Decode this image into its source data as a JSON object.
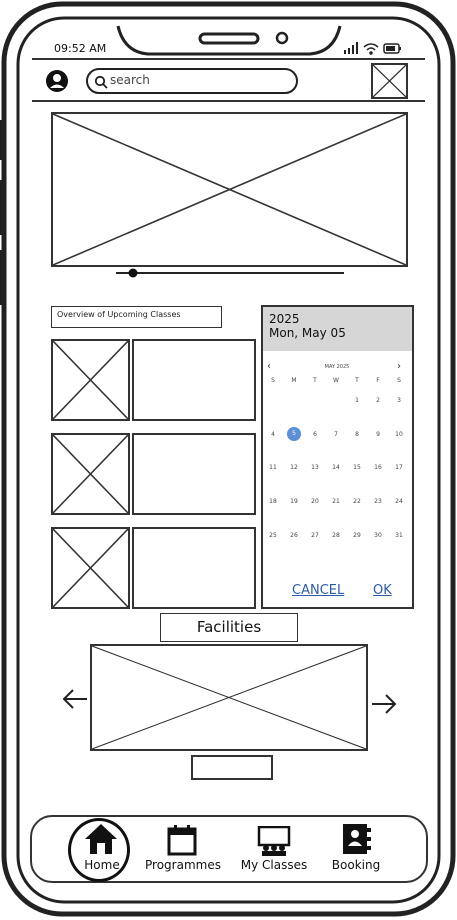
{
  "status_bar": {
    "time": "09:52 AM"
  },
  "header": {
    "search_placeholder": "search"
  },
  "upcoming": {
    "title": "Overview of Upcoming Classes"
  },
  "date_picker": {
    "year": "2025",
    "selected_date": "Mon, May 05",
    "month_label": "MAY 2025",
    "weekday_headers": [
      "S",
      "M",
      "T",
      "W",
      "T",
      "F",
      "S"
    ],
    "weeks": [
      [
        "",
        "",
        "",
        "",
        "1",
        "2",
        "3"
      ],
      [
        "4",
        "5",
        "6",
        "7",
        "8",
        "9",
        "10"
      ],
      [
        "11",
        "12",
        "13",
        "14",
        "15",
        "16",
        "17"
      ],
      [
        "18",
        "19",
        "20",
        "21",
        "22",
        "23",
        "24"
      ],
      [
        "25",
        "26",
        "27",
        "28",
        "29",
        "30",
        "31"
      ]
    ],
    "selected_day": "5",
    "cancel_label": "CANCEL",
    "ok_label": "OK"
  },
  "facilities": {
    "title": "Facilities"
  },
  "bottom_nav": {
    "home_label": "Home",
    "programmes_label": "Programmes",
    "my_classes_label": "My Classes",
    "booking_label": "Booking"
  },
  "colors": {
    "selected_day": "#5b8fd6",
    "link": "#2b5aa8",
    "header_band": "#d6d6d6",
    "outline": "#333333"
  }
}
